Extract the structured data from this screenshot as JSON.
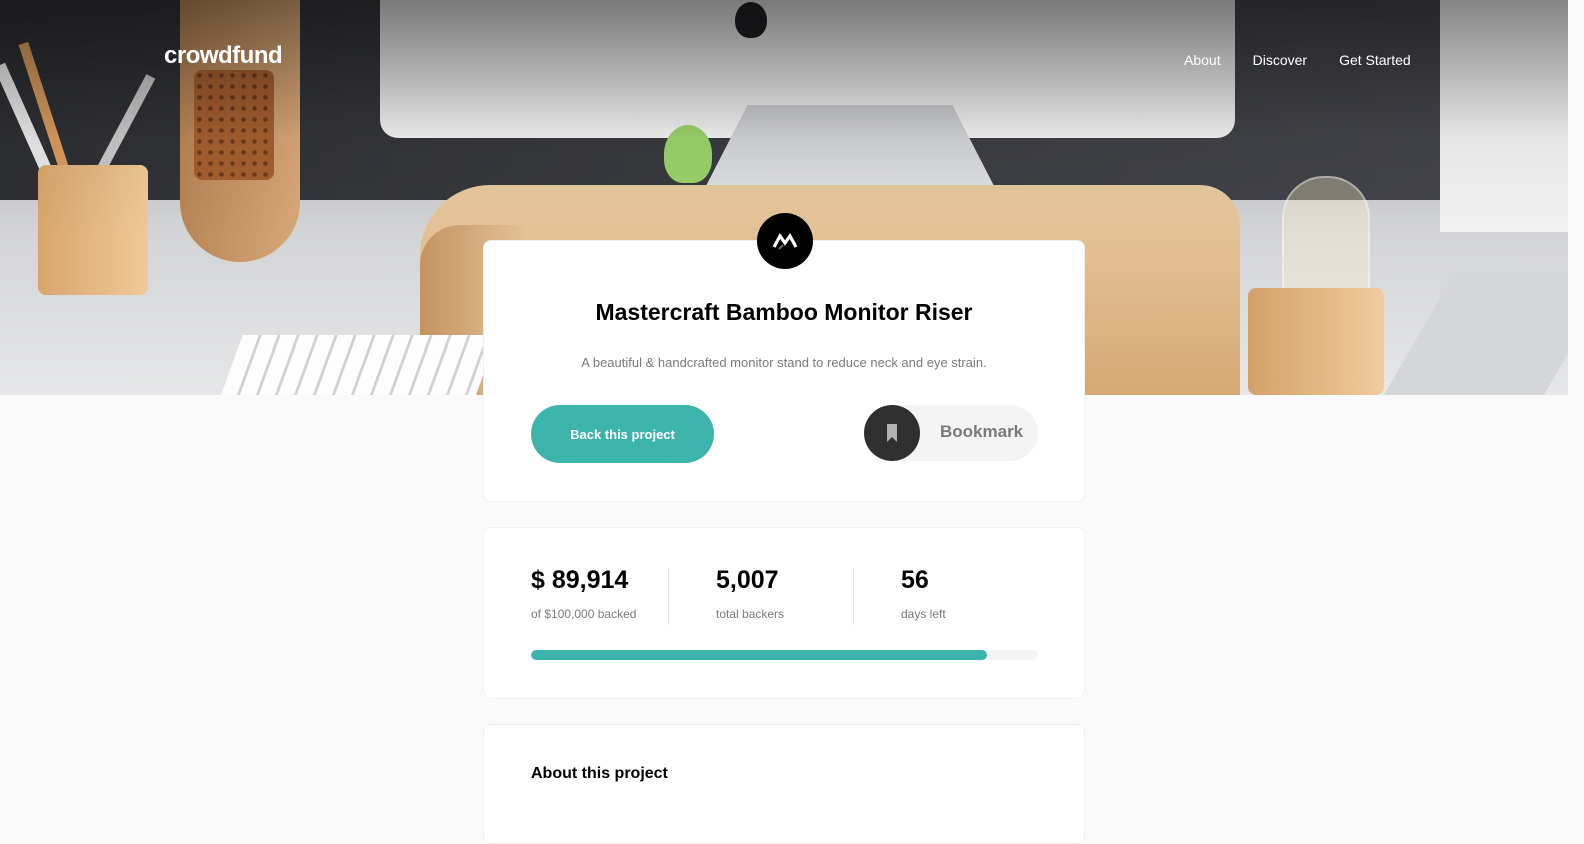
{
  "header": {
    "logo": "crowdfund",
    "nav": [
      "About",
      "Discover",
      "Get Started"
    ]
  },
  "project": {
    "title": "Mastercraft Bamboo Monitor Riser",
    "description": "A beautiful & handcrafted monitor stand to reduce neck and eye strain.",
    "back_button_label": "Back this project",
    "bookmark_label": "Bookmark"
  },
  "stats": {
    "backed_amount": "$ 89,914",
    "backed_label": "of $100,000 backed",
    "backers_count": "5,007",
    "backers_label": "total backers",
    "days_left": "56",
    "days_label": "days left",
    "progress_fraction": 0.899
  },
  "about": {
    "heading": "About this project"
  },
  "colors": {
    "accent": "#3cb4ac",
    "dark": "#2f2f2f",
    "muted_text": "#7a7a7a"
  },
  "icons": {
    "logo_mark": "mastercraft-logo-icon",
    "bookmark": "bookmark-icon"
  }
}
